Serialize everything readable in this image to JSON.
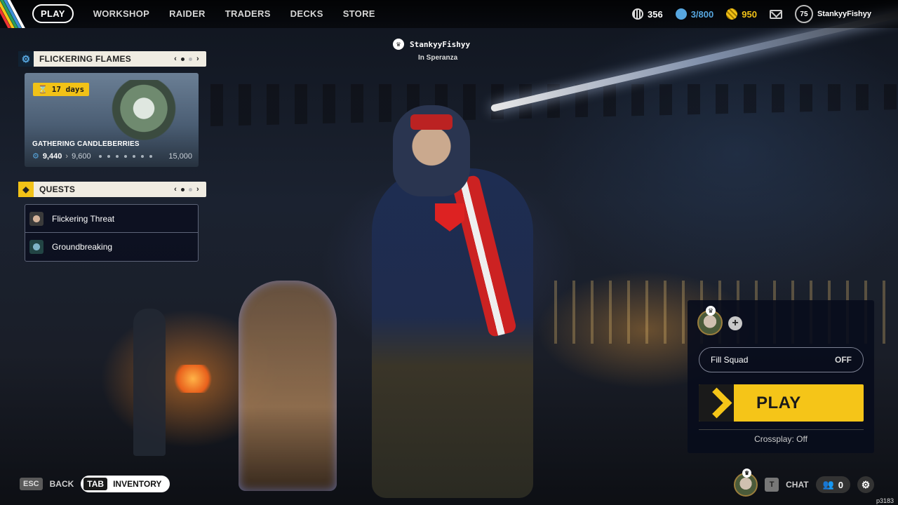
{
  "nav": {
    "items": [
      "PLAY",
      "WORKSHOP",
      "RAIDER",
      "TRADERS",
      "DECKS",
      "STORE"
    ],
    "active": "PLAY"
  },
  "currencies": {
    "coins": "356",
    "capacity": "3/800",
    "credits": "950",
    "capacity_color": "#57a7e0",
    "credits_color": "#f2c217"
  },
  "user": {
    "level": "75",
    "name": "StankyyFishyy"
  },
  "player_tag": {
    "name": "StankyyFishyy",
    "location": "In Speranza"
  },
  "event_panel": {
    "title": "FLICKERING FLAMES",
    "timer": "17 days",
    "event_name": "GATHERING CANDLEBERRIES",
    "current": "9,440",
    "next": "9,600",
    "max": "15,000"
  },
  "quests_panel": {
    "title": "QUESTS",
    "items": [
      "Flickering Threat",
      "Groundbreaking"
    ]
  },
  "squad": {
    "fill_label": "Fill Squad",
    "fill_value": "OFF",
    "play_label": "PLAY",
    "crossplay": "Crossplay: Off",
    "accent": "#f5c518"
  },
  "bottom": {
    "esc_key": "ESC",
    "back_label": "BACK",
    "tab_key": "TAB",
    "inventory_label": "INVENTORY",
    "chat_key": "T",
    "chat_label": "CHAT",
    "friends_count": "0",
    "version": "p3183"
  },
  "icons": {
    "coins": "coin-icon",
    "capacity": "stash-icon",
    "credits": "credits-icon",
    "mail": "mail-icon",
    "settings": "gear-icon",
    "friends": "friends-icon"
  }
}
